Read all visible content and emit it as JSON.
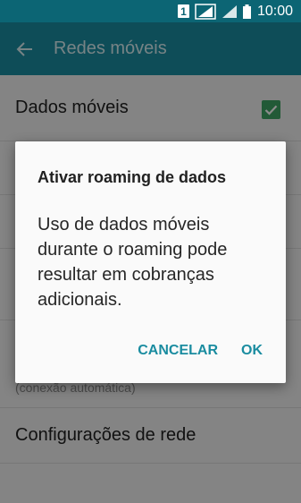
{
  "status_bar": {
    "sim_label": "1",
    "time": "10:00",
    "icons": [
      "sim-1-icon",
      "signal-strength-icon",
      "signal-strength-icon",
      "battery-icon"
    ]
  },
  "app_bar": {
    "title": "Redes móveis",
    "back_icon": "arrow-left-icon"
  },
  "list": {
    "mobile_data": {
      "title": "Dados móveis",
      "checked": true
    },
    "hidden_row_sub": "(conexão automática)",
    "network_settings": {
      "title": "Configurações de rede"
    }
  },
  "dialog": {
    "title": "Ativar roaming de dados",
    "message": "Uso de dados móveis durante o roaming pode resultar em cobranças adicionais.",
    "cancel_label": "CANCELAR",
    "ok_label": "OK"
  },
  "colors": {
    "status_bar": "#0c6574",
    "app_bar": "#1a8ca0",
    "accent": "#1a8ca0",
    "checkbox": "#3fa565"
  }
}
